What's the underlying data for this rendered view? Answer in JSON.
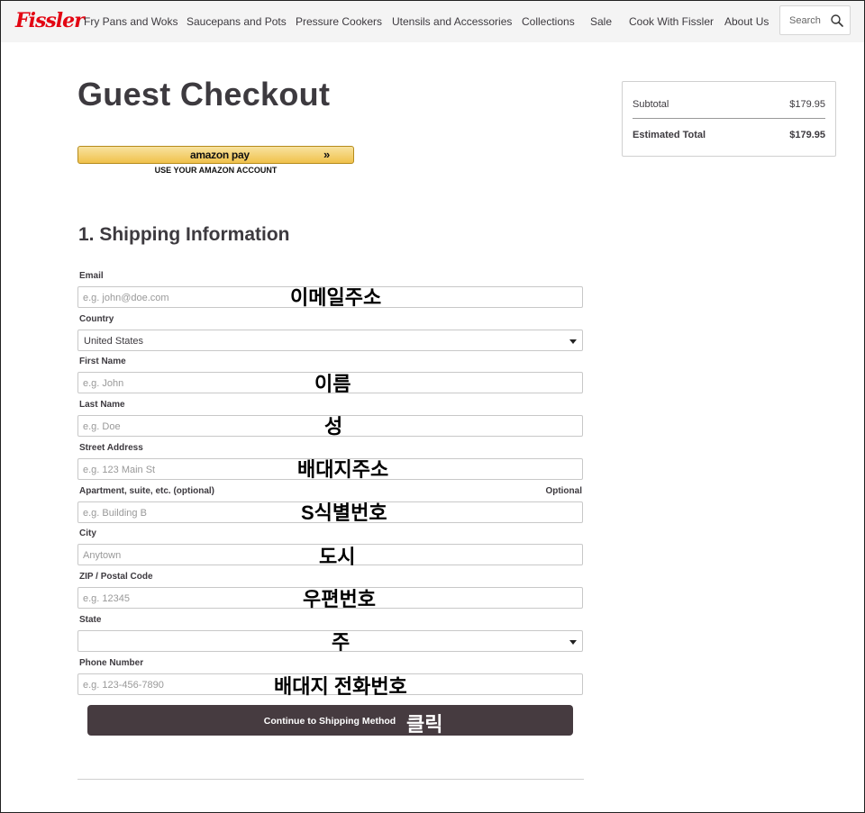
{
  "brand": "Fissler",
  "nav": [
    "Fry Pans and Woks",
    "Saucepans and Pots",
    "Pressure Cookers",
    "Utensils and Accessories",
    "Collections",
    "Sale",
    "Cook With Fissler",
    "About Us"
  ],
  "search": {
    "placeholder": "Search",
    "icon": "search-icon"
  },
  "title": "Guest Checkout",
  "amazon": {
    "logo": "amazon pay",
    "arrows": "»",
    "subtitle": "USE YOUR AMAZON ACCOUNT",
    "color": "#f0c14b"
  },
  "section_title": "1. Shipping Information",
  "form": {
    "email": {
      "label": "Email",
      "placeholder": "e.g. john@doe.com",
      "annotation": "이메일주소"
    },
    "country": {
      "label": "Country",
      "value": "United States"
    },
    "first_name": {
      "label": "First Name",
      "placeholder": "e.g. John",
      "annotation": "이름"
    },
    "last_name": {
      "label": "Last Name",
      "placeholder": "e.g. Doe",
      "annotation": "성"
    },
    "street": {
      "label": "Street Address",
      "placeholder": "e.g. 123 Main St",
      "annotation": "배대지주소"
    },
    "apartment": {
      "label": "Apartment, suite, etc. (optional)",
      "optional_tag": "Optional",
      "placeholder": "e.g. Building B",
      "annotation": "S식별번호"
    },
    "city": {
      "label": "City",
      "placeholder": "Anytown",
      "annotation": "도시"
    },
    "zip": {
      "label": "ZIP / Postal Code",
      "placeholder": "e.g. 12345",
      "annotation": "우편번호"
    },
    "state": {
      "label": "State",
      "value": "",
      "annotation": "주"
    },
    "phone": {
      "label": "Phone Number",
      "placeholder": "e.g. 123-456-7890",
      "annotation": "배대지 전화번호"
    }
  },
  "continue": {
    "label": "Continue to Shipping Method",
    "annotation": "클릭",
    "color": "#463b40"
  },
  "summary": {
    "subtotal_label": "Subtotal",
    "subtotal_value": "$179.95",
    "total_label": "Estimated Total",
    "total_value": "$179.95"
  },
  "colors": {
    "brand": "#e30613",
    "text": "#3d3a3f"
  }
}
